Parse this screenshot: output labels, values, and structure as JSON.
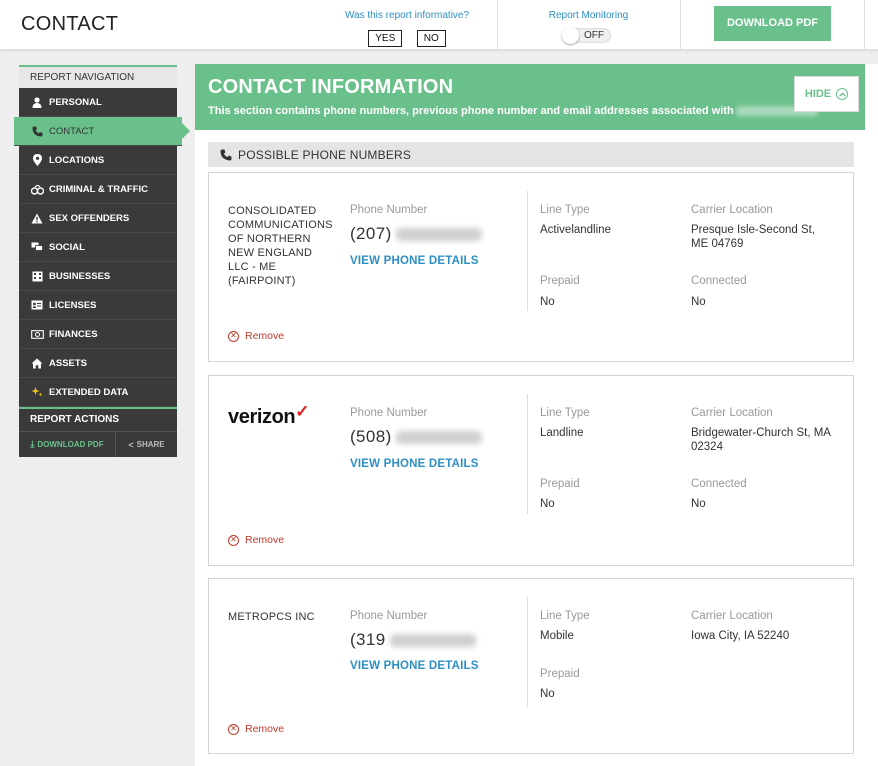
{
  "header": {
    "title": "CONTACT",
    "feedback_question": "Was this report informative?",
    "yes_label": "YES",
    "no_label": "NO",
    "monitoring_label": "Report Monitoring",
    "monitoring_state": "OFF",
    "download_label": "DOWNLOAD PDF"
  },
  "sidebar": {
    "nav_heading": "REPORT NAVIGATION",
    "items": [
      {
        "label": "PERSONAL",
        "icon": "person-icon"
      },
      {
        "label": "CONTACT",
        "icon": "phone-icon"
      },
      {
        "label": "LOCATIONS",
        "icon": "location-pin-icon"
      },
      {
        "label": "CRIMINAL & TRAFFIC",
        "icon": "handcuffs-icon"
      },
      {
        "label": "SEX OFFENDERS",
        "icon": "warning-icon"
      },
      {
        "label": "SOCIAL",
        "icon": "chat-icon"
      },
      {
        "label": "BUSINESSES",
        "icon": "building-icon"
      },
      {
        "label": "LICENSES",
        "icon": "id-card-icon"
      },
      {
        "label": "FINANCES",
        "icon": "money-icon"
      },
      {
        "label": "ASSETS",
        "icon": "house-icon"
      },
      {
        "label": "EXTENDED DATA",
        "icon": "sparkle-icon"
      }
    ],
    "actions_heading": "REPORT ACTIONS",
    "download_label": "DOWNLOAD PDF",
    "share_label": "SHARE"
  },
  "main": {
    "title": "CONTACT INFORMATION",
    "subtitle": "This section contains phone numbers, previous phone number and email addresses associated with",
    "hide_label": "HIDE",
    "section_title": "POSSIBLE PHONE NUMBERS",
    "labels": {
      "phone_number": "Phone Number",
      "view_details": "VIEW PHONE DETAILS",
      "line_type": "Line Type",
      "carrier_location": "Carrier Location",
      "prepaid": "Prepaid",
      "connected": "Connected",
      "remove": "Remove"
    },
    "phones": [
      {
        "carrier": "CONSOLIDATED COMMUNICATIONS OF NORTHERN NEW ENGLAND LLC - ME (FAIRPOINT)",
        "area_code": "(207)",
        "line_type": "Activelandline",
        "carrier_location": "Presque Isle-Second St, ME 04769",
        "prepaid": "No",
        "connected": "No"
      },
      {
        "carrier": "verizon",
        "area_code": "(508)",
        "line_type": "Landline",
        "carrier_location": "Bridgewater-Church St, MA 02324",
        "prepaid": "No",
        "connected": "No"
      },
      {
        "carrier": "METROPCS INC",
        "area_code": "(319",
        "line_type": "Mobile",
        "carrier_location": "Iowa City, IA 52240",
        "prepaid": "No"
      }
    ]
  },
  "colors": {
    "accent_green": "#6ac08b",
    "link_blue": "#2e8fc4",
    "sidebar_dark": "#3a3a3a",
    "remove_red": "#c0392b",
    "verizon_red": "#e02020"
  }
}
